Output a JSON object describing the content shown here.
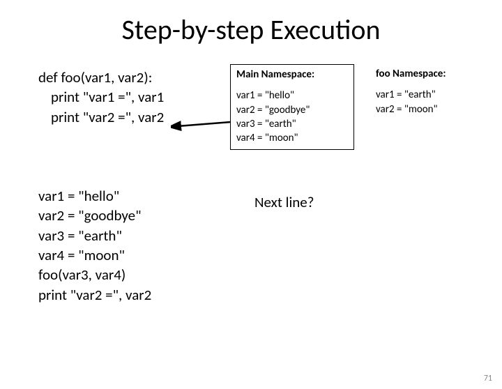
{
  "title": "Step-by-step Execution",
  "codeTop": {
    "l1": "def foo(var1, var2):",
    "l2": "print \"var1 =\", var1",
    "l3": "print \"var2 =\", var2"
  },
  "codeBottom": {
    "l1": "var1 = \"hello\"",
    "l2": "var2 = \"goodbye\"",
    "l3": "var3 = \"earth\"",
    "l4": "var4 = \"moon\"",
    "l5": "foo(var3, var4)",
    "l6": "print \"var2 =\", var2"
  },
  "mainNs": {
    "title": "Main Namespace:",
    "v1": "var1 = \"hello\"",
    "v2": "var2 = \"goodbye\"",
    "v3": "var3 = \"earth\"",
    "v4": "var4 = \"moon\""
  },
  "fooNs": {
    "title": "foo Namespace:",
    "v1": "var1 = \"earth\"",
    "v2": "var2 = \"moon\""
  },
  "nextLine": "Next line?",
  "pageNum": "71"
}
